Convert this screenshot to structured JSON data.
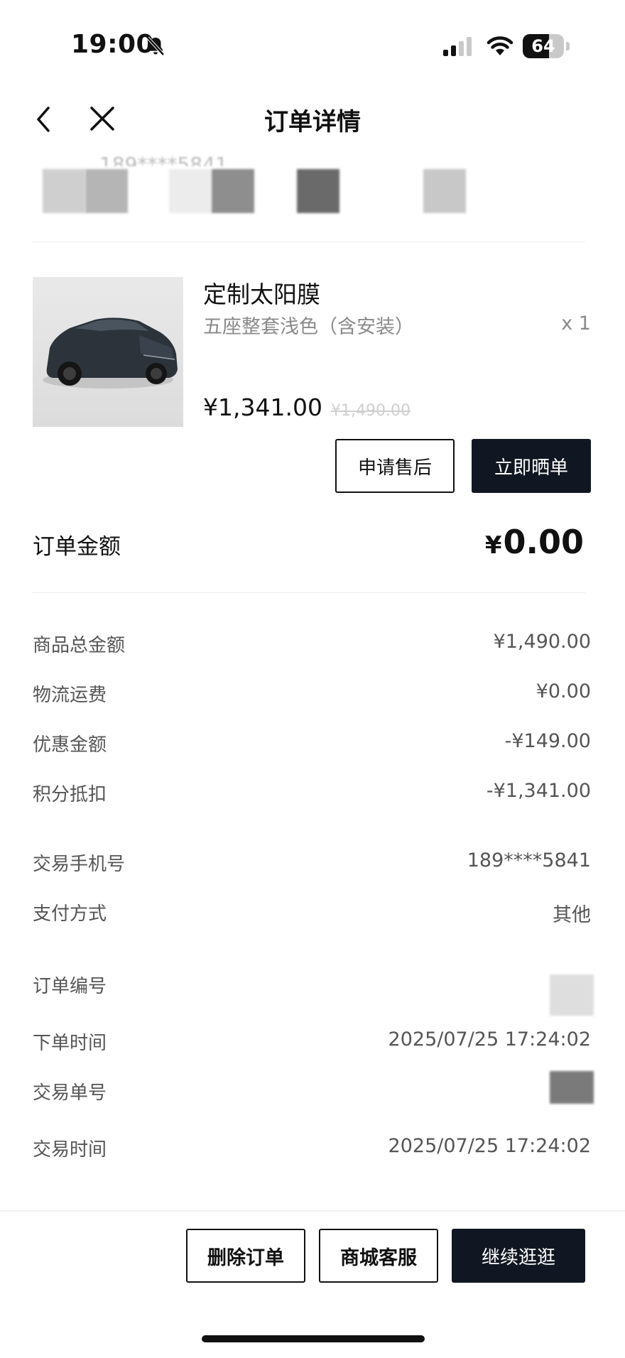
{
  "status_bar": {
    "time": "19:00",
    "battery": "64",
    "battery_level": 0.64,
    "icons": [
      "bell-slash-icon",
      "signal-icon",
      "wifi-icon",
      "battery-icon"
    ]
  },
  "nav": {
    "title": "订单详情",
    "back_icon": "chevron-left-icon",
    "close_icon": "close-icon"
  },
  "header_info": {
    "phone_faint": "189****5841"
  },
  "product": {
    "name": "定制太阳膜",
    "spec": "五座整套浅色（含安装）",
    "qty": "x 1",
    "price": "¥1,341.00",
    "original_price": "¥1,490.00",
    "image": "car-image"
  },
  "actions": {
    "after_sale": "申请售后",
    "share": "立即晒单"
  },
  "order_amount": {
    "label": "订单金额",
    "currency": "¥",
    "value": "0.00"
  },
  "price_rows": [
    {
      "label": "商品总金额",
      "value": "¥1,490.00"
    },
    {
      "label": "物流运费",
      "value": "¥0.00"
    },
    {
      "label": "优惠金额",
      "value": "-¥149.00"
    },
    {
      "label": "积分抵扣",
      "value": "-¥1,341.00"
    }
  ],
  "pay_rows": [
    {
      "label": "交易手机号",
      "value": "189****5841"
    },
    {
      "label": "支付方式",
      "value": "其他"
    }
  ],
  "info_rows": [
    {
      "label": "订单编号",
      "value": ""
    },
    {
      "label": "下单时间",
      "value": "2025/07/25 17:24:02"
    },
    {
      "label": "交易单号",
      "value": ""
    },
    {
      "label": "交易时间",
      "value": "2025/07/25 17:24:02"
    }
  ],
  "footer": {
    "delete": "删除订单",
    "service": "商城客服",
    "continue": "继续逛逛"
  },
  "colors": {
    "accent_dark": "#111722",
    "text_primary": "#111111",
    "text_secondary": "#555555",
    "text_muted": "#8a8a8a"
  }
}
